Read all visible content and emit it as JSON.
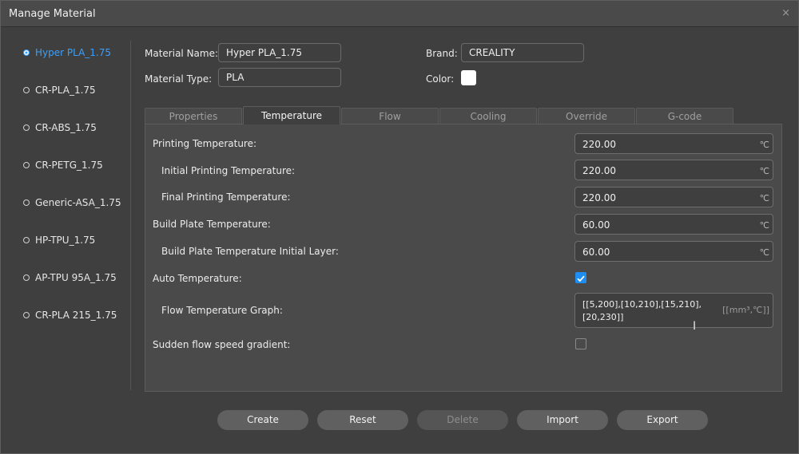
{
  "window": {
    "title": "Manage Material",
    "close_glyph": "×"
  },
  "sidebar": {
    "items": [
      {
        "label": "Hyper PLA_1.75",
        "active": true
      },
      {
        "label": "CR-PLA_1.75"
      },
      {
        "label": "CR-ABS_1.75"
      },
      {
        "label": "CR-PETG_1.75"
      },
      {
        "label": "Generic-ASA_1.75"
      },
      {
        "label": "HP-TPU_1.75"
      },
      {
        "label": "AP-TPU 95A_1.75"
      },
      {
        "label": "CR-PLA 215_1.75"
      }
    ]
  },
  "header": {
    "material_name_label": "Material Name:",
    "material_name_value": "Hyper PLA_1.75",
    "material_type_label": "Material Type:",
    "material_type_value": "PLA",
    "brand_label": "Brand:",
    "brand_value": "CREALITY",
    "color_label": "Color:",
    "color_value": "#ffffff"
  },
  "tabs": [
    "Properties",
    "Temperature",
    "Flow",
    "Cooling",
    "Override",
    "G-code"
  ],
  "active_tab": "Temperature",
  "temperature": {
    "printing_label": "Printing Temperature:",
    "printing_value": "220.00",
    "initial_printing_label": "Initial Printing Temperature:",
    "initial_printing_value": "220.00",
    "final_printing_label": "Final Printing Temperature:",
    "final_printing_value": "220.00",
    "build_plate_label": "Build Plate Temperature:",
    "build_plate_value": "60.00",
    "build_plate_initial_label": "Build Plate Temperature Initial Layer:",
    "build_plate_initial_value": "60.00",
    "unit": "℃",
    "auto_label": "Auto Temperature:",
    "auto_checked": true,
    "flow_graph_label": "Flow Temperature Graph:",
    "flow_graph_value": "[[5,200],[10,210],[15,210],[20,230]]",
    "flow_graph_unit": "[[mm³,℃]]",
    "sudden_label": "Sudden flow speed gradient:",
    "sudden_checked": false
  },
  "buttons": {
    "create": "Create",
    "reset": "Reset",
    "delete": "Delete",
    "import": "Import",
    "export": "Export"
  },
  "colors": {
    "accent": "#38a1ff",
    "checkbox": "#1e8ff0"
  }
}
